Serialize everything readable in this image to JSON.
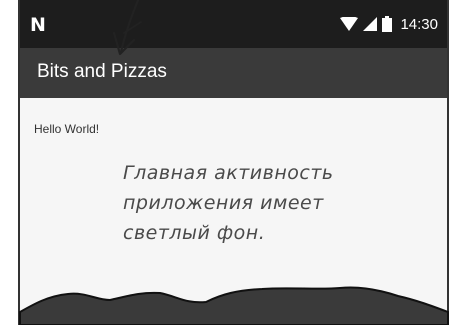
{
  "status_bar": {
    "logo_icon": "android-n-logo-icon",
    "wifi_icon": "wifi-icon",
    "signal_icon": "signal-icon",
    "battery_icon": "battery-icon",
    "time": "14:30"
  },
  "app_bar": {
    "title": "Bits and Pizzas"
  },
  "content": {
    "text": "Hello World!"
  },
  "annotation": {
    "lines": [
      "Главная активность",
      "приложения имеет",
      "светлый фон."
    ]
  },
  "colors": {
    "status_bar": "#1d1d1d",
    "app_bar": "#3a3a3a",
    "background": "#f6f6f6",
    "annotation_ink": "#4a4a4a"
  }
}
